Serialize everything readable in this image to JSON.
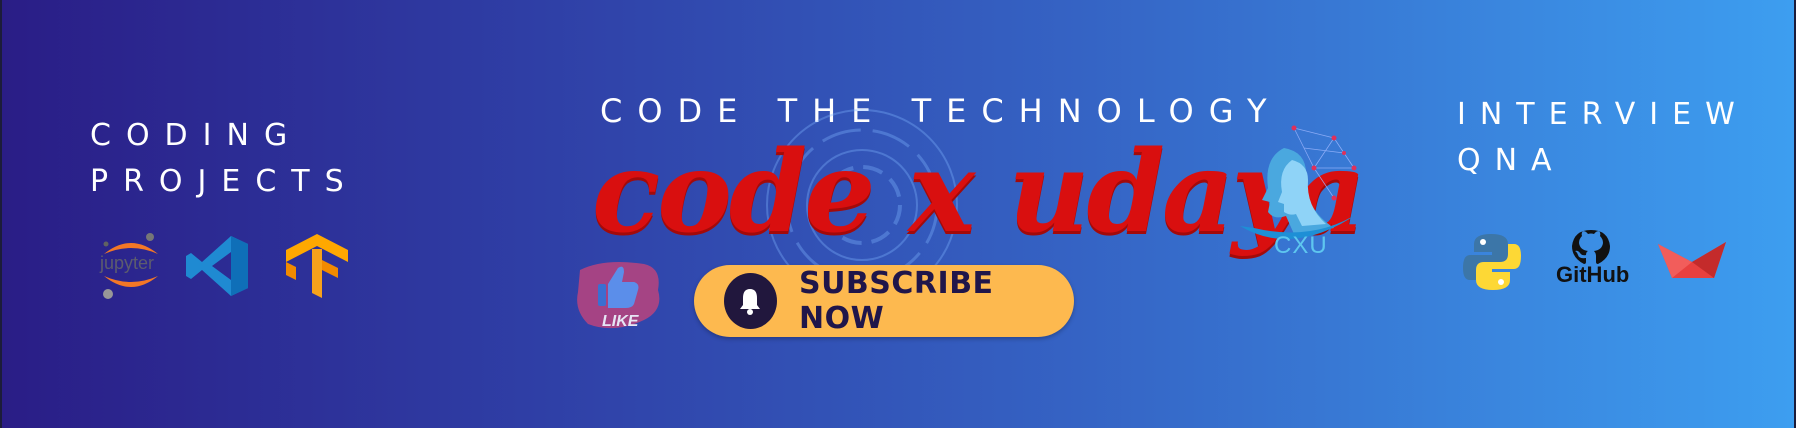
{
  "left": {
    "title_line1": "CODING",
    "title_line2": "PROJECTS",
    "jupyter_label": "jupyter"
  },
  "center": {
    "tagline": "CODE THE TECHNOLOGY",
    "brand": "code x udaya",
    "subscribe_label": "SUBSCRIBE NOW",
    "like_label": "LIKE",
    "logo_label": "CXU"
  },
  "right": {
    "title_line1": "INTERVIEW",
    "title_line2": "QNA",
    "github_label": "GitHub"
  },
  "colors": {
    "brand_red": "#d90f0f",
    "subscribe_bg": "#fdb94f",
    "bell_bg": "#21173d",
    "gradient_start": "#2a1d86",
    "gradient_end": "#3d9ef0"
  },
  "icons": [
    "jupyter-icon",
    "vscode-icon",
    "tensorflow-icon",
    "like-sticker-icon",
    "bell-icon",
    "cxu-logo-icon",
    "python-icon",
    "github-icon",
    "scikit-boat-icon"
  ]
}
